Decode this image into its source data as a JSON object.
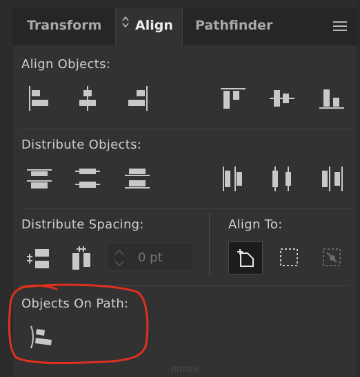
{
  "tabs": [
    {
      "label": "Transform",
      "active": false
    },
    {
      "label": "Align",
      "active": true
    },
    {
      "label": "Pathfinder",
      "active": false
    }
  ],
  "sections": {
    "align_objects": {
      "title": "Align Objects:"
    },
    "distribute_objects": {
      "title": "Distribute Objects:"
    },
    "distribute_spacing": {
      "title": "Distribute Spacing:",
      "spacing_placeholder": "0 pt"
    },
    "align_to": {
      "title": "Align To:",
      "selected": "key-object"
    },
    "objects_on_path": {
      "title": "Objects On Path:"
    }
  },
  "colors": {
    "panel_bg": "#323232",
    "tab_bar_bg": "#262626",
    "icon": "#c8c8c8",
    "annotation": "#e0301e"
  },
  "icons": [
    "horizontal-align-left-icon",
    "horizontal-align-center-icon",
    "horizontal-align-right-icon",
    "vertical-align-top-icon",
    "vertical-align-center-icon",
    "vertical-align-bottom-icon",
    "vertical-distribute-top-icon",
    "vertical-distribute-center-icon",
    "vertical-distribute-bottom-icon",
    "horizontal-distribute-left-icon",
    "horizontal-distribute-center-icon",
    "horizontal-distribute-right-icon",
    "vertical-distribute-space-icon",
    "horizontal-distribute-space-icon",
    "align-to-key-object-icon",
    "align-to-selection-icon",
    "align-to-artboard-icon",
    "align-on-path-icon",
    "panel-menu-icon"
  ]
}
